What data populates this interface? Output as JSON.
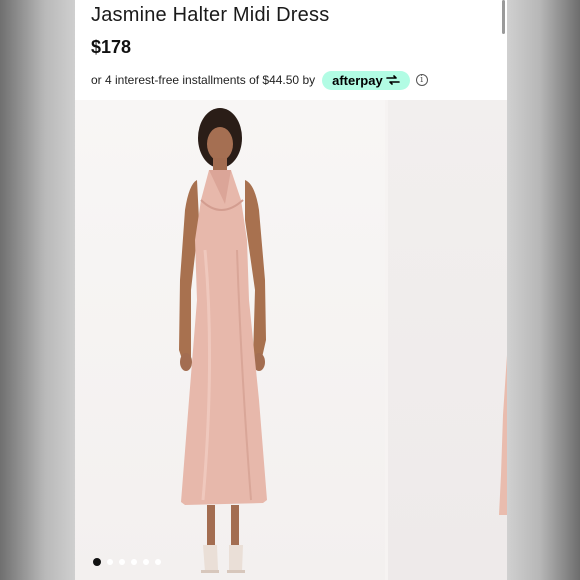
{
  "product": {
    "title": "Jasmine Halter Midi Dress",
    "price": "$178",
    "installments_text": "or 4 interest-free installments of $44.50 by",
    "afterpay_label": "afterpay",
    "info_symbol": "i"
  },
  "gallery": {
    "slide_count": 6,
    "active_index": 0
  },
  "colors": {
    "afterpay_badge": "#b2fce4",
    "dress": "#e7b8ab"
  }
}
